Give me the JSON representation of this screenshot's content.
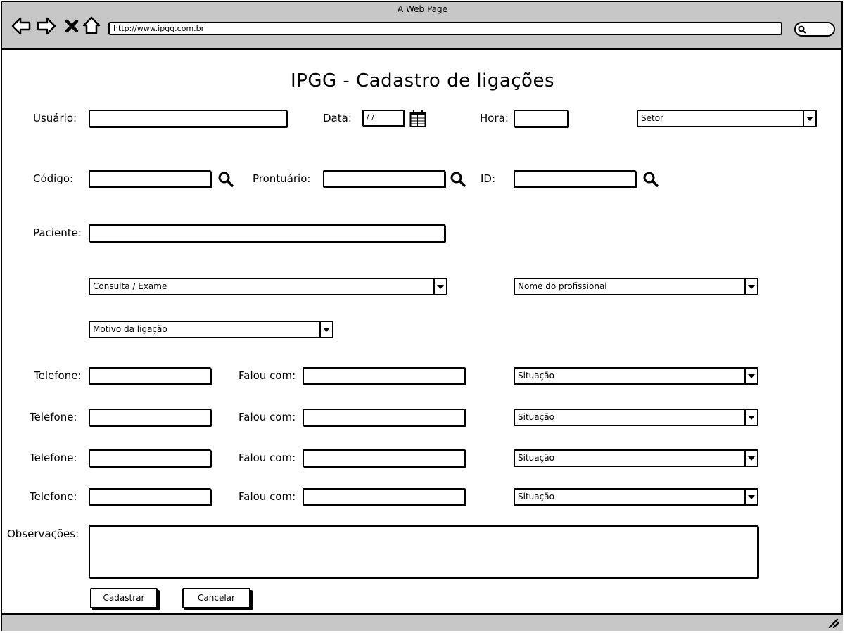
{
  "window": {
    "title": "A Web Page"
  },
  "browser": {
    "url": "http://www.ipgg.com.br",
    "icons": [
      "back-arrow-icon",
      "forward-arrow-icon",
      "close-x-icon",
      "home-icon",
      "search-icon"
    ]
  },
  "page": {
    "title": "IPGG - Cadastro de ligações"
  },
  "form": {
    "usuario_label": "Usuário:",
    "data_label": "Data:",
    "data_value": "/ /",
    "hora_label": "Hora:",
    "setor_select": "Setor",
    "codigo_label": "Código:",
    "prontuario_label": "Prontuário:",
    "id_label": "ID:",
    "paciente_label": "Paciente:",
    "consulta_select": "Consulta / Exame",
    "profissional_select": "Nome do profissional",
    "motivo_select": "Motivo da ligação",
    "phones": [
      {
        "telefone_label": "Telefone:",
        "falou_label": "Falou com:",
        "situacao": "Situação"
      },
      {
        "telefone_label": "Telefone:",
        "falou_label": "Falou com:",
        "situacao": "Situação"
      },
      {
        "telefone_label": "Telefone:",
        "falou_label": "Falou com:",
        "situacao": "Situação"
      },
      {
        "telefone_label": "Telefone:",
        "falou_label": "Falou com:",
        "situacao": "Situação"
      }
    ],
    "observacoes_label": "Observações:",
    "cadastrar_button": "Cadastrar",
    "cancelar_button": "Cancelar"
  }
}
